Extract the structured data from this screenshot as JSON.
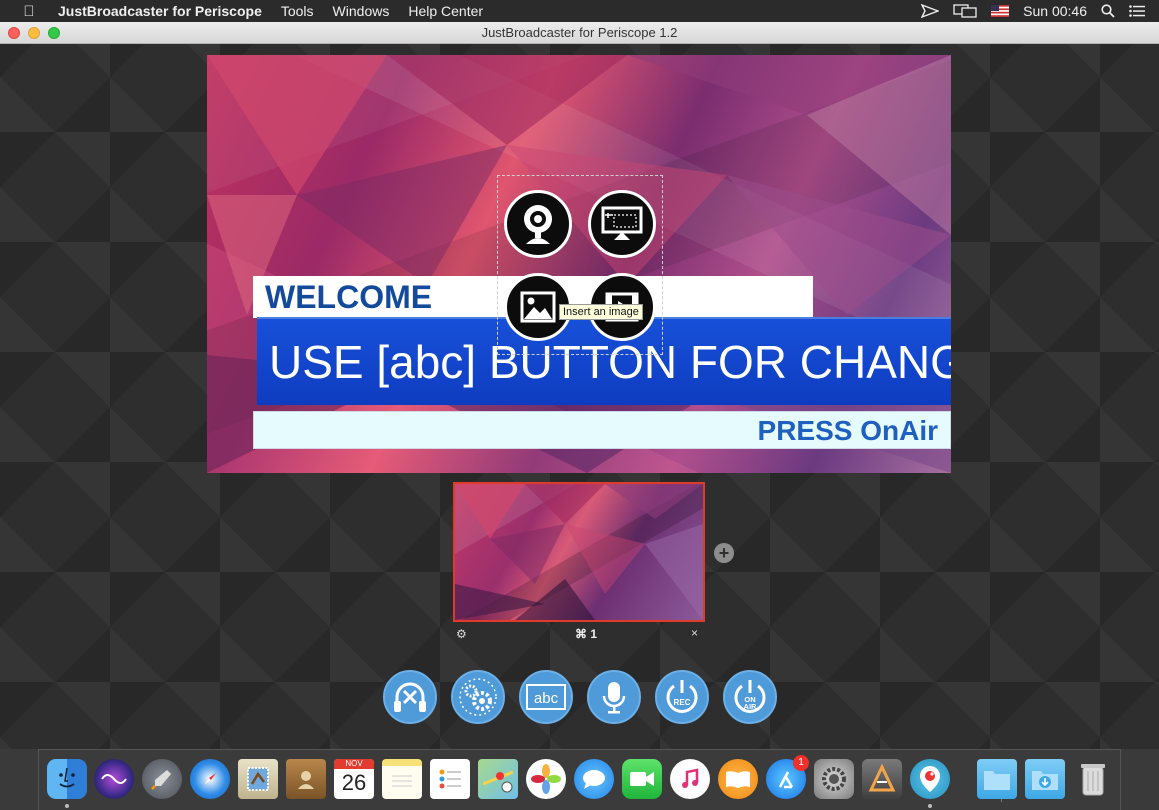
{
  "menubar": {
    "app_name": "JustBroadcaster for Periscope",
    "menus": [
      "Tools",
      "Windows",
      "Help Center"
    ],
    "clock": "Sun 00:46"
  },
  "window": {
    "title": "JustBroadcaster for Periscope 1.2"
  },
  "preview": {
    "welcome": "WELCOME",
    "banner": "USE [abc] BUTTON FOR CHANGE",
    "press": "PRESS  OnAir",
    "tooltip": "Insert an image",
    "sources": [
      "webcam-source",
      "screen-capture-source",
      "image-source",
      "video-source"
    ]
  },
  "scenes": {
    "label": "⌘ 1",
    "settings_glyph": "⚙",
    "close_glyph": "×",
    "add_glyph": "+"
  },
  "controls": [
    "audio-off",
    "settings",
    "text-abc",
    "microphone",
    "rec",
    "on-air"
  ],
  "control_labels": {
    "abc": "abc",
    "rec": "REC",
    "on": "ON",
    "air": "AIR"
  },
  "dock": {
    "calendar_month": "NOV",
    "calendar_day": "26",
    "app_store_badge": "1"
  },
  "colors": {
    "accent": "#4f9ad9",
    "selected_scene": "#e03a2a",
    "banner_blue": "#1750d8",
    "title_blue": "#144a9c"
  }
}
